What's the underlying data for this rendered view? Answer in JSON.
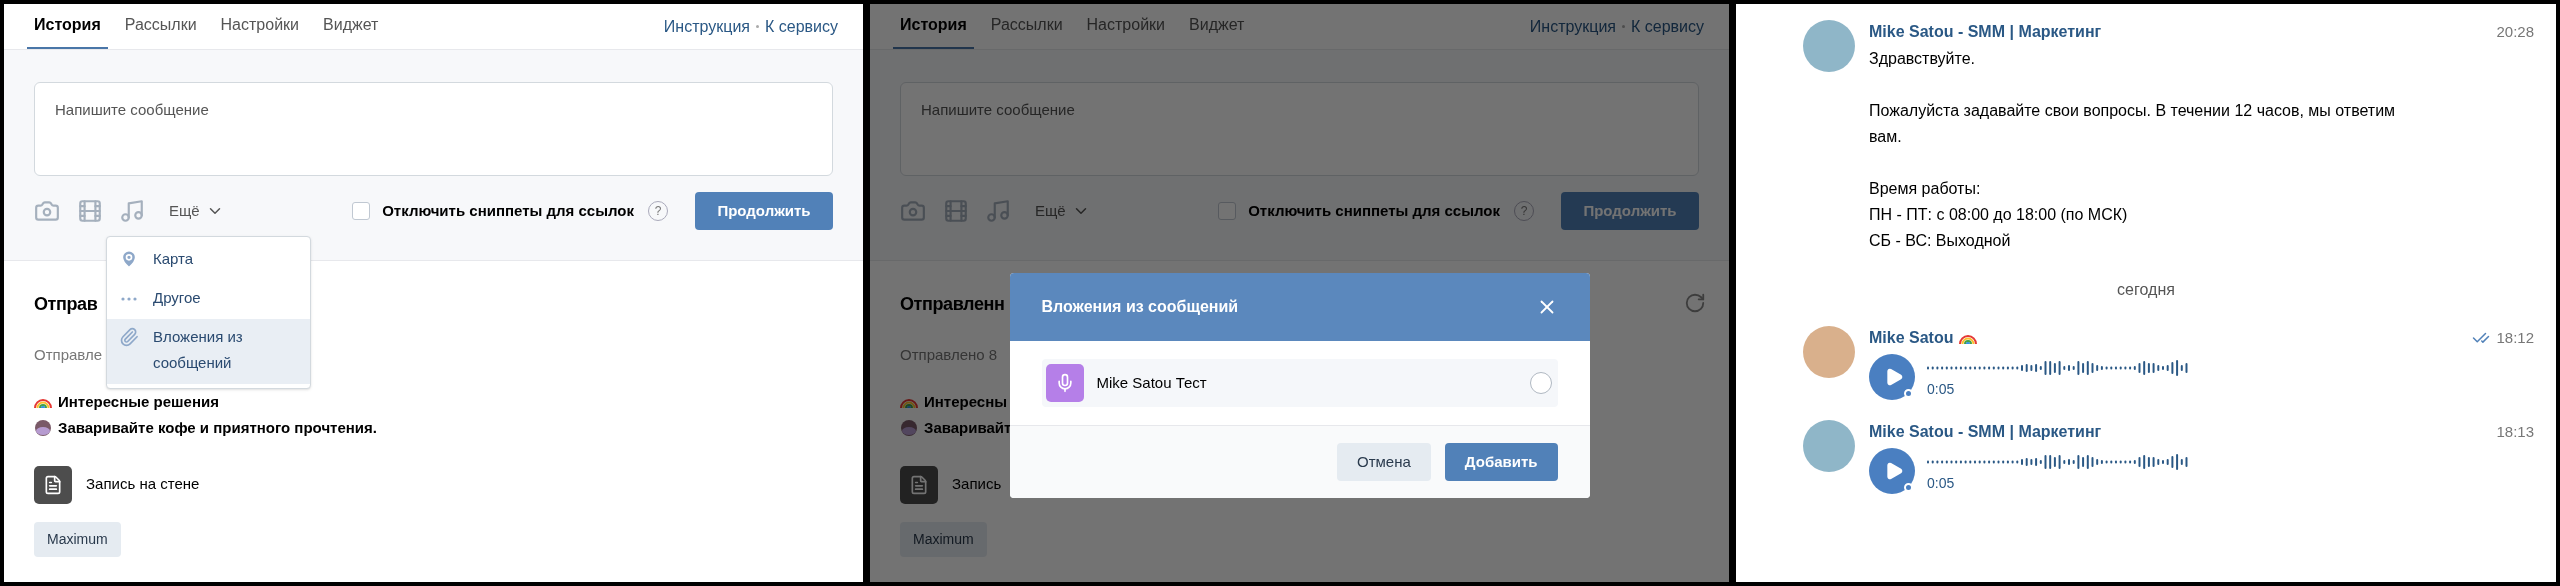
{
  "panels": [
    {
      "tabs": [
        {
          "label": "История",
          "selected": true
        },
        {
          "label": "Рассылки",
          "selected": false
        },
        {
          "label": "Настройки",
          "selected": false
        },
        {
          "label": "Виджет",
          "selected": false
        }
      ],
      "links": [
        "Инструкция",
        "К сервису"
      ],
      "composer": {
        "placeholder": "Напишите сообщение",
        "more": "Ещё",
        "snippets": {
          "label": "Отключить сниппеты для ссылок",
          "checked": false
        },
        "help": "?",
        "submit": "Продолжить"
      },
      "sent": {
        "heading": "Отправ",
        "subheading": "Отправле",
        "lines": [
          {
            "kind": "rainbow",
            "text": "Интересные решения"
          },
          {
            "kind": "bean",
            "text": "Заваривайте кофе и приятного прочтения."
          }
        ],
        "post": "Запись на стене",
        "tag": "Maximum"
      },
      "dropdown": {
        "items": [
          {
            "kind": "pin",
            "label": "Карта",
            "selected": false
          },
          {
            "kind": "dots",
            "label": "Другое",
            "selected": false
          },
          {
            "kind": "clip",
            "label": "Вложения из сообщений",
            "selected": true
          }
        ]
      }
    },
    {
      "tabs": [
        {
          "label": "История",
          "selected": true
        },
        {
          "label": "Рассылки",
          "selected": false
        },
        {
          "label": "Настройки",
          "selected": false
        },
        {
          "label": "Виджет",
          "selected": false
        }
      ],
      "links": [
        "Инструкция",
        "К сервису"
      ],
      "composer": {
        "placeholder": "Напишите сообщение",
        "more": "Ещё",
        "snippets": {
          "label": "Отключить сниппеты для ссылок",
          "checked": false
        },
        "help": "?",
        "submit": "Продолжить"
      },
      "sent": {
        "heading": "Отправленн",
        "subheading": "Отправлено 8",
        "lines": [
          {
            "kind": "rainbow",
            "text": "Интересны"
          },
          {
            "kind": "bean",
            "text": "Заваривайт"
          }
        ],
        "post": "Запись",
        "tag": "Maximum"
      },
      "modal": {
        "title": "Вложения из сообщений",
        "items": [
          {
            "label": "Mike Satou Тест",
            "selected": false
          }
        ],
        "cancel": "Отмена",
        "confirm": "Добавить"
      }
    }
  ],
  "chat": {
    "messages": [
      {
        "kind": "text",
        "name": "Mike Satou - SMM | Маркетинг",
        "rainbow": false,
        "read": false,
        "time": "20:28",
        "paragraphs": [
          [
            "Здравствуйте."
          ],
          [
            "Пожалуйста задавайте свои вопросы. В течении 12 часов, мы ответим вам."
          ],
          [
            "Время работы:",
            "ПН - ПТ: с 08:00 до 18:00 (по МСК)",
            "СБ - ВС: Выходной"
          ]
        ]
      },
      {
        "kind": "divider",
        "label": "сегодня"
      },
      {
        "kind": "voice",
        "name": "Mike Satou",
        "rainbow": true,
        "read": true,
        "time": "18:12",
        "duration": "0:05"
      },
      {
        "kind": "voice",
        "name": "Mike Satou - SMM | Маркетинг",
        "rainbow": false,
        "read": false,
        "time": "18:13",
        "duration": "0:05"
      }
    ]
  }
}
